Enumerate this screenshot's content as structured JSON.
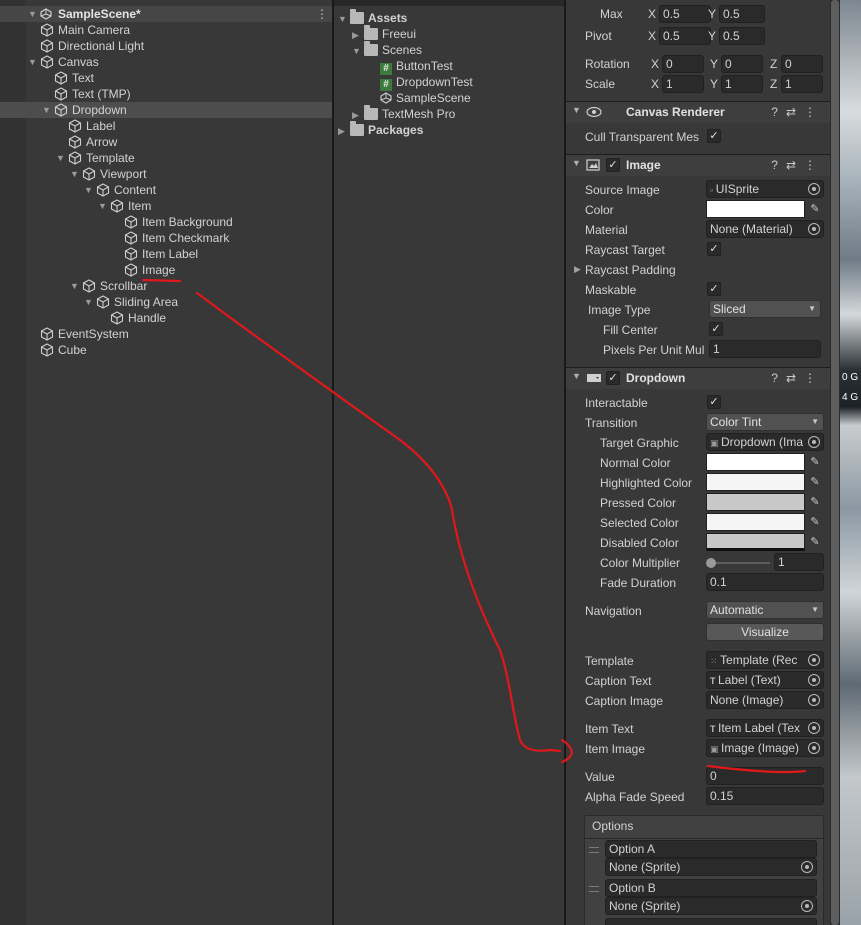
{
  "hierarchy": {
    "scene_name": "SampleScene*",
    "items": [
      {
        "label": "Main Camera",
        "depth": 1,
        "icon": "cube-icon"
      },
      {
        "label": "Directional Light",
        "depth": 1,
        "icon": "cube-icon"
      },
      {
        "label": "Canvas",
        "depth": 1,
        "icon": "cube-icon",
        "expanded": true
      },
      {
        "label": "Text",
        "depth": 2,
        "icon": "cube-icon"
      },
      {
        "label": "Text (TMP)",
        "depth": 2,
        "icon": "cube-icon"
      },
      {
        "label": "Dropdown",
        "depth": 2,
        "icon": "cube-icon",
        "expanded": true,
        "selected": true
      },
      {
        "label": "Label",
        "depth": 3,
        "icon": "cube-icon"
      },
      {
        "label": "Arrow",
        "depth": 3,
        "icon": "cube-icon"
      },
      {
        "label": "Template",
        "depth": 3,
        "icon": "cube-icon",
        "expanded": true
      },
      {
        "label": "Viewport",
        "depth": 4,
        "icon": "cube-icon",
        "expanded": true
      },
      {
        "label": "Content",
        "depth": 5,
        "icon": "cube-icon",
        "expanded": true
      },
      {
        "label": "Item",
        "depth": 6,
        "icon": "cube-icon",
        "expanded": true
      },
      {
        "label": "Item Background",
        "depth": 7,
        "icon": "cube-icon"
      },
      {
        "label": "Item Checkmark",
        "depth": 7,
        "icon": "cube-icon"
      },
      {
        "label": "Item Label",
        "depth": 7,
        "icon": "cube-icon"
      },
      {
        "label": "Image",
        "depth": 7,
        "icon": "cube-icon"
      },
      {
        "label": "Scrollbar",
        "depth": 4,
        "icon": "cube-icon",
        "expanded": true
      },
      {
        "label": "Sliding Area",
        "depth": 5,
        "icon": "cube-icon",
        "expanded": true
      },
      {
        "label": "Handle",
        "depth": 6,
        "icon": "cube-icon"
      },
      {
        "label": "EventSystem",
        "depth": 1,
        "icon": "cube-icon"
      },
      {
        "label": "Cube",
        "depth": 1,
        "icon": "cube-icon"
      }
    ]
  },
  "project": {
    "assets_label": "Assets",
    "freeui_label": "Freeui",
    "scenes_label": "Scenes",
    "button_test": "ButtonTest",
    "dropdown_test": "DropdownTest",
    "sample_scene": "SampleScene",
    "textmesh_pro": "TextMesh Pro",
    "packages_label": "Packages",
    "script_glyph": "#"
  },
  "rect_transform": {
    "max_label": "Max",
    "max_x": "0.5",
    "max_y": "0.5",
    "pivot_label": "Pivot",
    "pivot_x": "0.5",
    "pivot_y": "0.5",
    "rotation_label": "Rotation",
    "rot_x": "0",
    "rot_y": "0",
    "rot_z": "0",
    "scale_label": "Scale",
    "scale_x": "1",
    "scale_y": "1",
    "scale_z": "1",
    "x": "X",
    "y": "Y",
    "z": "Z"
  },
  "canvas_renderer": {
    "title": "Canvas Renderer",
    "cull_label": "Cull Transparent Mes",
    "cull_checked": true
  },
  "image": {
    "title": "Image",
    "source_image_label": "Source Image",
    "source_image_value": "UISprite",
    "color_label": "Color",
    "color_value": "#ffffff",
    "material_label": "Material",
    "material_value": "None (Material)",
    "raycast_target_label": "Raycast Target",
    "raycast_padding_label": "Raycast Padding",
    "maskable_label": "Maskable",
    "image_type_label": "Image Type",
    "image_type_value": "Sliced",
    "fill_center_label": "Fill Center",
    "ppu_label": "Pixels Per Unit Mul",
    "ppu_value": "1"
  },
  "dropdown": {
    "title": "Dropdown",
    "interactable_label": "Interactable",
    "transition_label": "Transition",
    "transition_value": "Color Tint",
    "target_graphic_label": "Target Graphic",
    "target_graphic_value": "Dropdown (Ima",
    "normal_color_label": "Normal Color",
    "highlighted_color_label": "Highlighted Color",
    "pressed_color_label": "Pressed Color",
    "selected_color_label": "Selected Color",
    "disabled_color_label": "Disabled Color",
    "color_multiplier_label": "Color Multiplier",
    "color_multiplier_value": "1",
    "fade_duration_label": "Fade Duration",
    "fade_duration_value": "0.1",
    "navigation_label": "Navigation",
    "navigation_value": "Automatic",
    "visualize_label": "Visualize",
    "template_label": "Template",
    "template_value": "Template (Rec",
    "caption_text_label": "Caption Text",
    "caption_text_value": "Label (Text)",
    "caption_image_label": "Caption Image",
    "caption_image_value": "None (Image)",
    "item_text_label": "Item Text",
    "item_text_value": "Item Label (Tex",
    "item_image_label": "Item Image",
    "item_image_value": "Image (Image)",
    "value_label": "Value",
    "value_value": "0",
    "alpha_fade_label": "Alpha Fade Speed",
    "alpha_fade_value": "0.15",
    "options_label": "Options",
    "options": [
      {
        "text": "Option A",
        "sprite": "None (Sprite)"
      },
      {
        "text": "Option B",
        "sprite": "None (Sprite)"
      }
    ]
  },
  "background_stats": {
    "line1": "0 G",
    "line2": "4 G"
  },
  "colors": {
    "panel_bg": "#383838",
    "field_bg": "#2a2a2a",
    "selection": "#4d4d4d",
    "annotation_red": "#e0181c"
  }
}
